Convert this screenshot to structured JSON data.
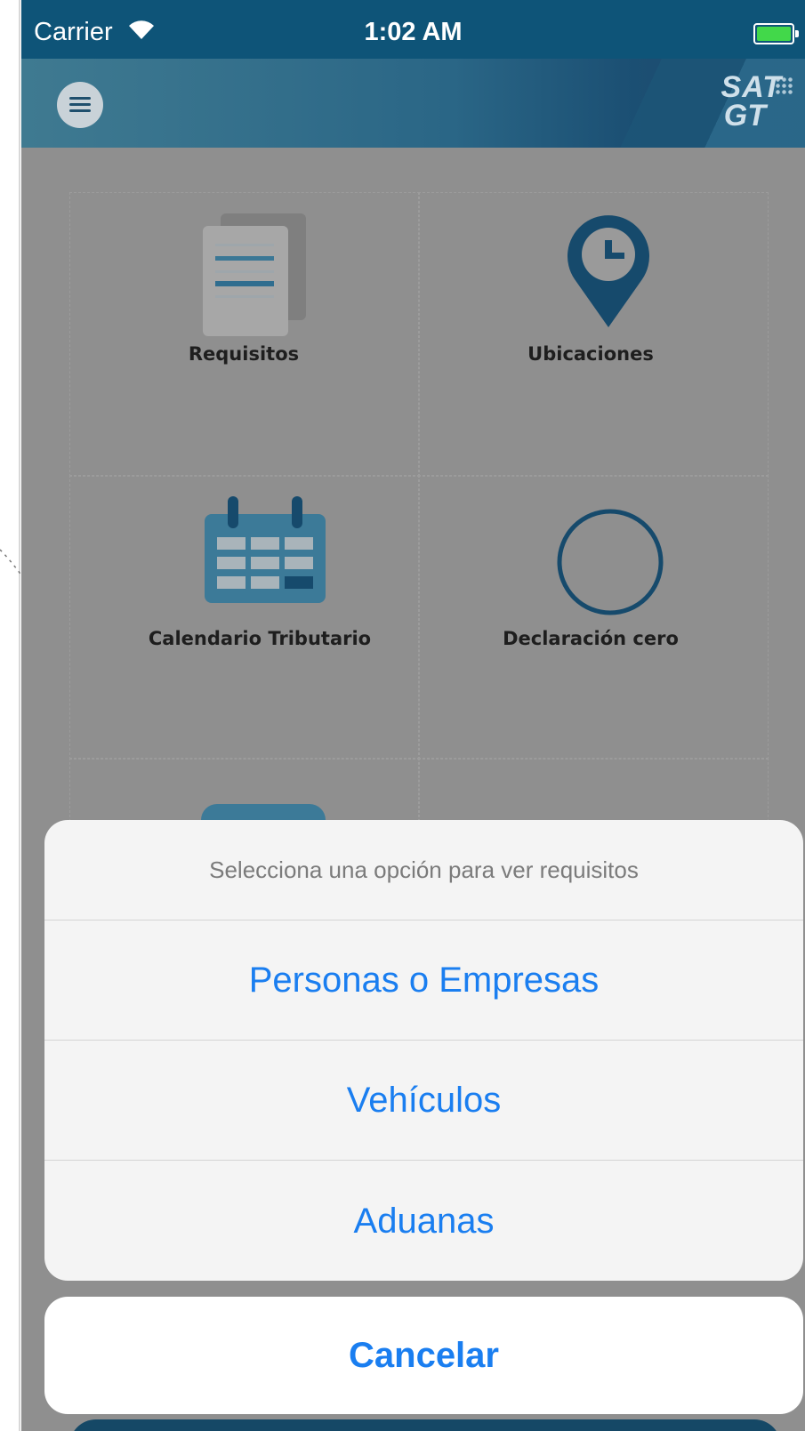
{
  "status_bar": {
    "carrier": "Carrier",
    "time": "1:02 AM"
  },
  "header": {
    "logo_line1": "SAT",
    "logo_line2": "GT"
  },
  "tiles": [
    {
      "label": "Requisitos",
      "icon": "documents-icon"
    },
    {
      "label": "Ubicaciones",
      "icon": "location-clock-pin-icon"
    },
    {
      "label": "Calendario Tributario",
      "icon": "calendar-icon"
    },
    {
      "label": "Declaración cero",
      "icon": "circle-icon"
    }
  ],
  "action_sheet": {
    "title": "Selecciona una opción para ver requisitos",
    "options": [
      "Personas o Empresas",
      "Vehículos",
      "Aduanas"
    ],
    "cancel": "Cancelar"
  },
  "colors": {
    "status_bar": "#0e5478",
    "accent_blue": "#1a7ef0",
    "icon_dark": "#164a6c",
    "icon_mid": "#3c7a98"
  }
}
